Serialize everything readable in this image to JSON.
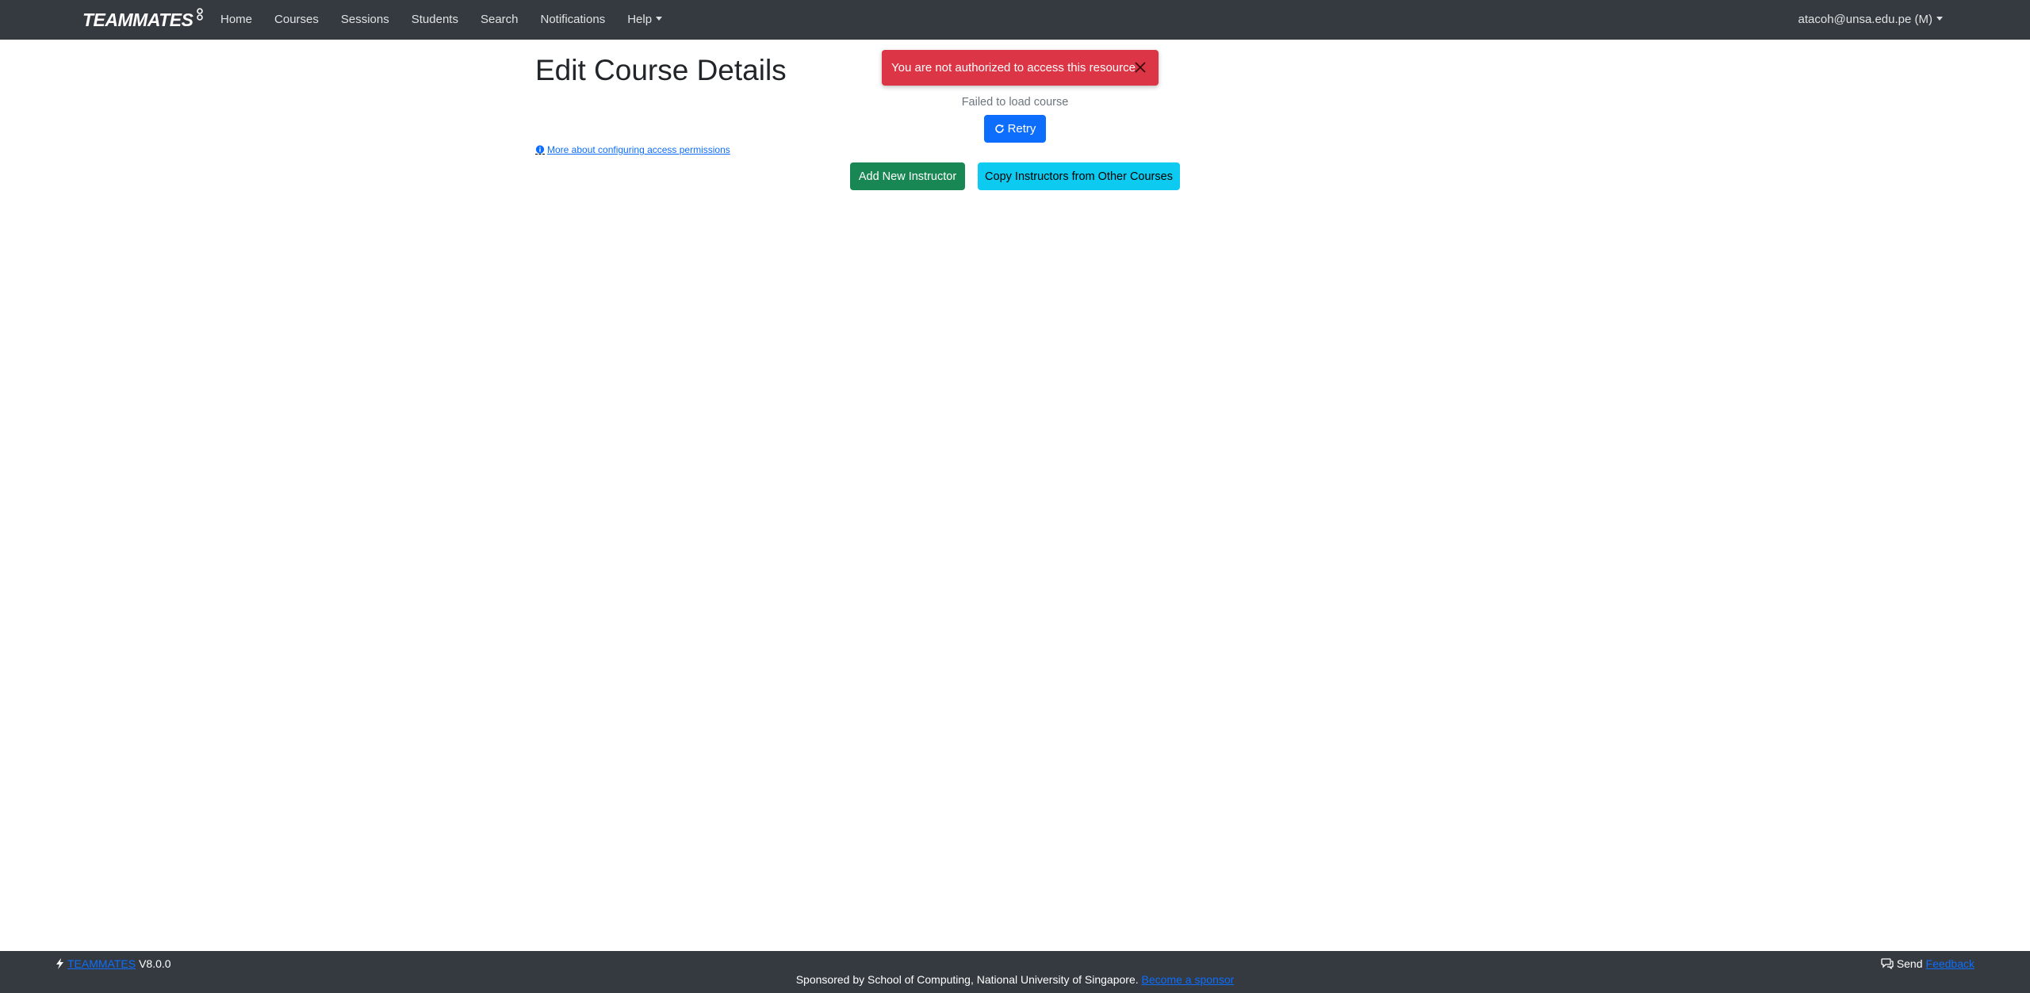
{
  "navbar": {
    "brand": "TEAMMATES",
    "links": [
      "Home",
      "Courses",
      "Sessions",
      "Students",
      "Search",
      "Notifications",
      "Help"
    ],
    "user": "atacoh@unsa.edu.pe (M)"
  },
  "toast": {
    "message": "You are not authorized to access this resource.",
    "color": "#dc3545"
  },
  "main": {
    "title": "Edit Course Details",
    "fail_message": "Failed to load course",
    "retry_label": "Retry",
    "permissions_link": "More about configuring access permissions",
    "add_instructor_label": "Add New Instructor",
    "copy_instructors_label": "Copy Instructors from Other Courses"
  },
  "footer": {
    "brand_link": "TEAMMATES",
    "version": "V8.0.0",
    "sponsor_text": "Sponsored by School of Computing, National University of Singapore.",
    "sponsor_link": "Become a sponsor",
    "send_label": "Send",
    "feedback_link": "Feedback"
  },
  "icons": {
    "brand_logo": "people-network-icon",
    "close": "close-icon",
    "retry": "refresh-icon",
    "info": "info-circle-icon",
    "bolt": "lightning-icon",
    "chat": "chat-icon"
  }
}
